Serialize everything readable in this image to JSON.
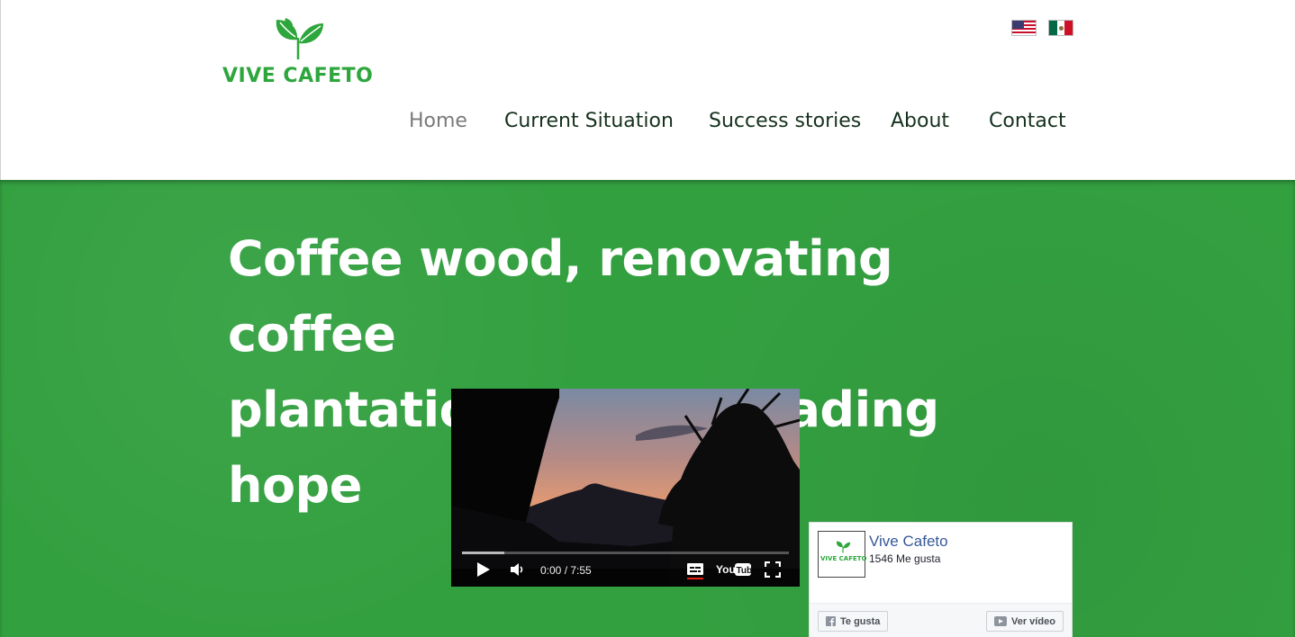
{
  "brand": {
    "name": "VIVE CAFETO",
    "color": "#2da63c"
  },
  "languages": [
    {
      "flag": "us-flag-icon"
    },
    {
      "flag": "mx-flag-icon"
    }
  ],
  "nav": {
    "items": [
      {
        "label": "Home",
        "active": true
      },
      {
        "label": "Current Situation",
        "active": false
      },
      {
        "label": "Success stories",
        "active": false
      },
      {
        "label": "About",
        "active": false
      },
      {
        "label": "Contact",
        "active": false
      }
    ]
  },
  "hero": {
    "title_line1": "Coffee wood, renovating coffee",
    "title_line2": "plantations and spreading hope",
    "background_color": "#33a040"
  },
  "video": {
    "time": "0:00 / 7:55",
    "progress": 0.13,
    "icons": [
      "play-icon",
      "volume-icon",
      "subtitles-icon",
      "youtube-logo",
      "fullscreen-icon"
    ]
  },
  "facebook": {
    "page_name": "Vive Cafeto",
    "likes": "1546 Me gusta",
    "like_button": "Te gusta",
    "video_button": "Ver vídeo",
    "logo_text": "VIVE CAFETO",
    "link_color": "#365899"
  }
}
